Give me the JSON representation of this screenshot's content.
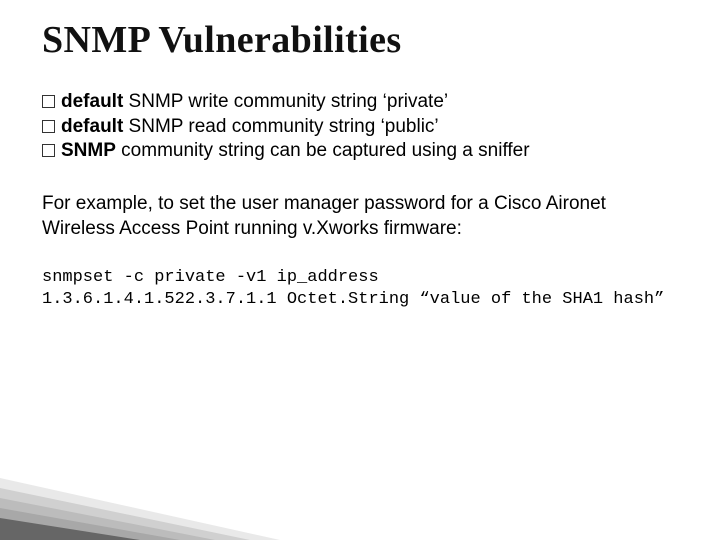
{
  "title": "SNMP Vulnerabilities",
  "bullets": [
    {
      "lead": "default",
      "rest": " SNMP write community string ‘private’"
    },
    {
      "lead": "default",
      "rest": " SNMP read community string ‘public’"
    },
    {
      "lead": "SNMP",
      "rest": " community string can be captured using a sniffer"
    }
  ],
  "example_intro": "For example, to set the user manager password for a Cisco Aironet Wireless Access Point running v.Xworks firmware:",
  "code_line1": "snmpset -c private -v1 ip_address",
  "code_line2": "1.3.6.1.4.1.522.3.7.1.1 Octet.String “value of the SHA1 hash”",
  "decor": {
    "c1": "#e9e9e9",
    "c2": "#d0d0d0",
    "c3": "#bcbcbc",
    "c4": "#a8a8a8",
    "c5": "#666666"
  }
}
